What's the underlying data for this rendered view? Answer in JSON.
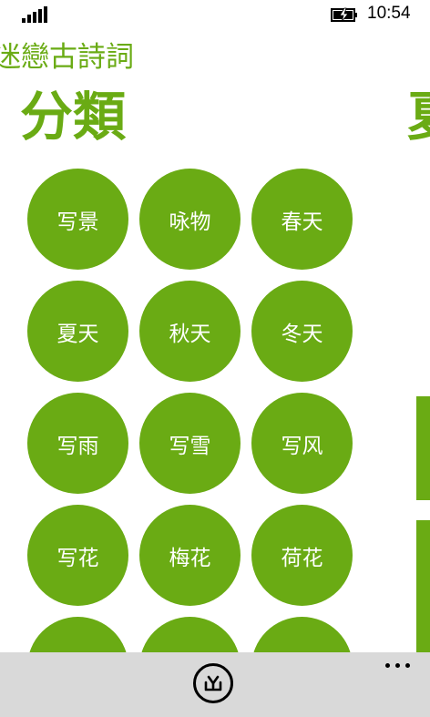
{
  "status": {
    "time": "10:54",
    "signal_icon": "signal-bars-icon",
    "battery_icon": "battery-charging-icon"
  },
  "app": {
    "title": "迷戀古詩詞",
    "accent_color": "#6aab14"
  },
  "pivot": {
    "current": "分類",
    "next": "夏"
  },
  "categories": [
    "写景",
    "咏物",
    "春天",
    "夏天",
    "秋天",
    "冬天",
    "写雨",
    "写雪",
    "写风",
    "写花",
    "梅花",
    "荷花",
    "",
    "",
    ""
  ],
  "app_bar": {
    "button_icon": "recycle-icon",
    "more_icon": "ellipsis-icon"
  }
}
